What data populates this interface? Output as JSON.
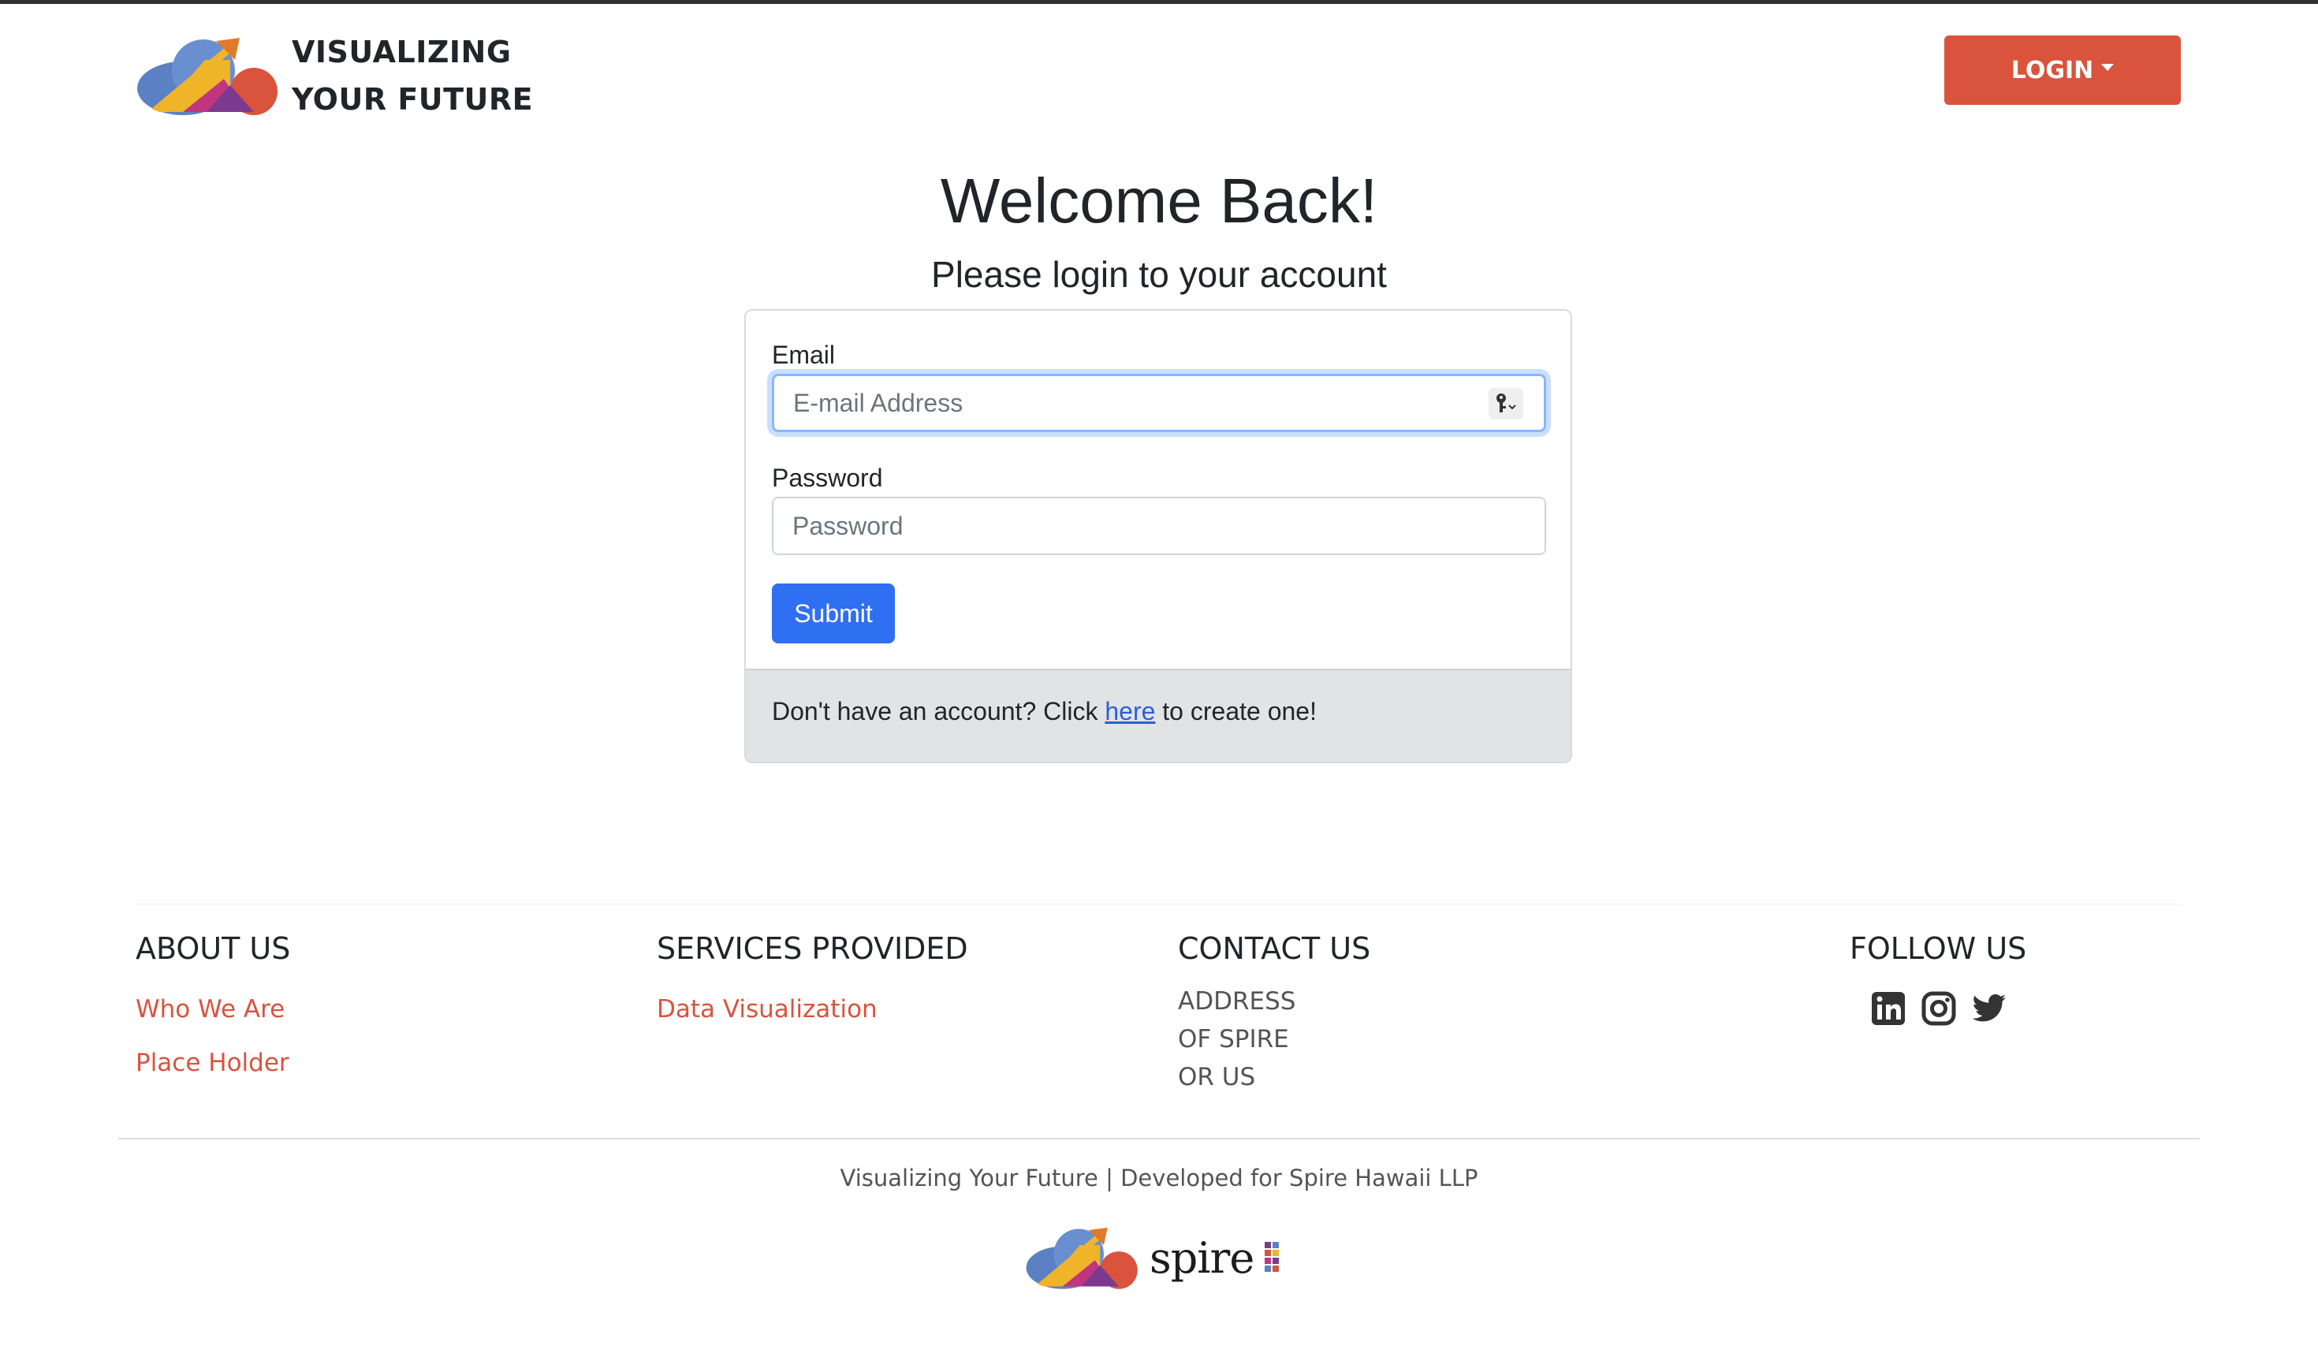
{
  "header": {
    "brand_line1": "VISUALIZING",
    "brand_line2": "YOUR FUTURE",
    "login_label": "LOGIN"
  },
  "main": {
    "title": "Welcome Back!",
    "subtitle": "Please login to your account",
    "form": {
      "email_label": "Email",
      "email_placeholder": "E-mail Address",
      "email_value": "",
      "password_label": "Password",
      "password_placeholder": "Password",
      "password_value": "",
      "submit_label": "Submit"
    },
    "signup": {
      "prefix": "Don't have an account? Click ",
      "link": "here",
      "suffix": " to create one!"
    }
  },
  "footer": {
    "about": {
      "heading": "ABOUT US",
      "links": [
        "Who We Are",
        "Place Holder"
      ]
    },
    "services": {
      "heading": "SERVICES PROVIDED",
      "links": [
        "Data Visualization"
      ]
    },
    "contact": {
      "heading": "CONTACT US",
      "address": [
        "ADDRESS",
        "OF SPIRE",
        "OR US"
      ]
    },
    "follow": {
      "heading": "FOLLOW US",
      "icons": [
        "linkedin-icon",
        "instagram-icon",
        "twitter-icon"
      ]
    },
    "credit": "Visualizing Your Future | Developed for Spire Hawaii LLP",
    "spire_wordmark": "spire"
  },
  "colors": {
    "accent": "#d9533d",
    "primary": "#2f6ff1",
    "focus": "#86b7fe"
  }
}
